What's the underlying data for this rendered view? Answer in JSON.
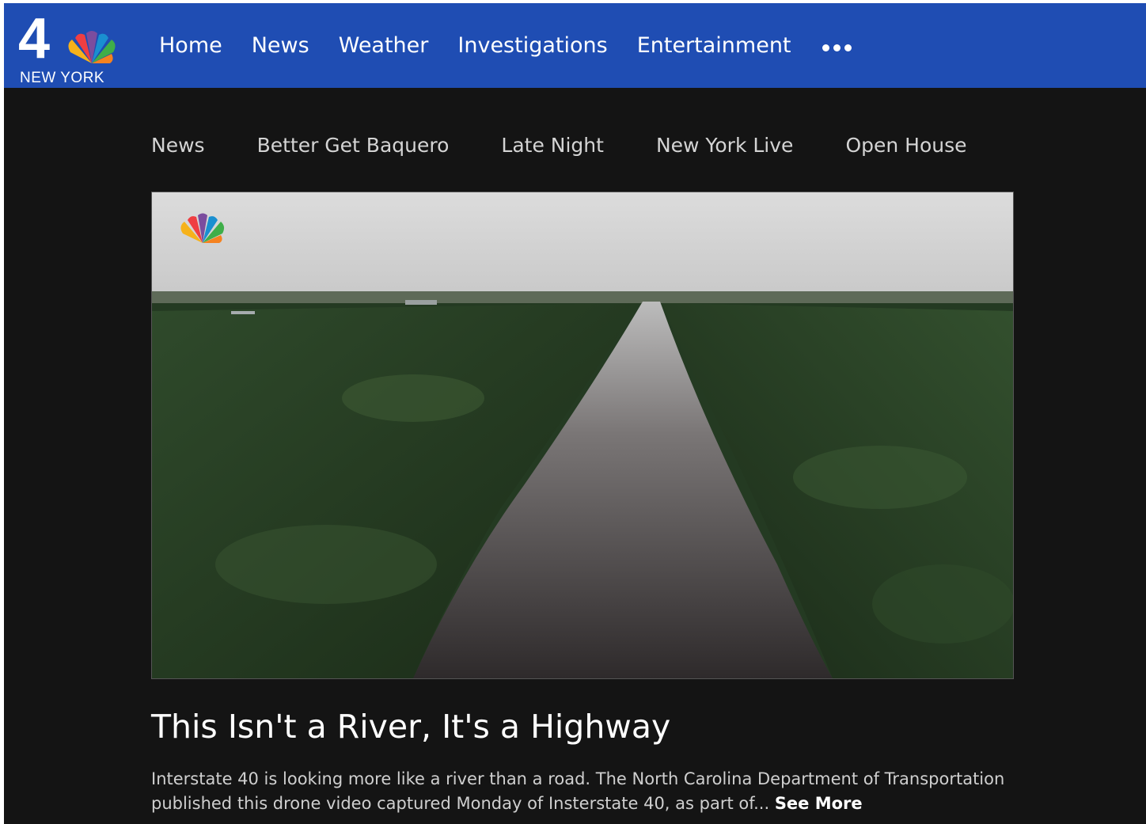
{
  "brand": {
    "channel_number": "4",
    "location": "NEW YORK",
    "logo_icon": "nbc-peacock-icon"
  },
  "main_nav": {
    "items": [
      {
        "label": "Home"
      },
      {
        "label": "News"
      },
      {
        "label": "Weather"
      },
      {
        "label": "Investigations"
      },
      {
        "label": "Entertainment"
      }
    ],
    "more_icon": "more-dots-icon"
  },
  "sub_nav": {
    "items": [
      {
        "label": "News"
      },
      {
        "label": "Better Get Baquero"
      },
      {
        "label": "Late Night"
      },
      {
        "label": "New York Live"
      },
      {
        "label": "Open House"
      }
    ]
  },
  "video": {
    "watermark_icon": "nbc-peacock-icon"
  },
  "article": {
    "headline": "This Isn't a River, It's a Highway",
    "summary": "Interstate 40 is looking more like a river than a road. The North Carolina Department of Transportation published this drone video captured Monday of Insterstate 40, as part of...",
    "see_more": "See More"
  },
  "colors": {
    "header_blue": "#1f4db3",
    "page_background": "#141414",
    "text_white": "#ffffff",
    "text_muted": "#cfcfcf"
  }
}
